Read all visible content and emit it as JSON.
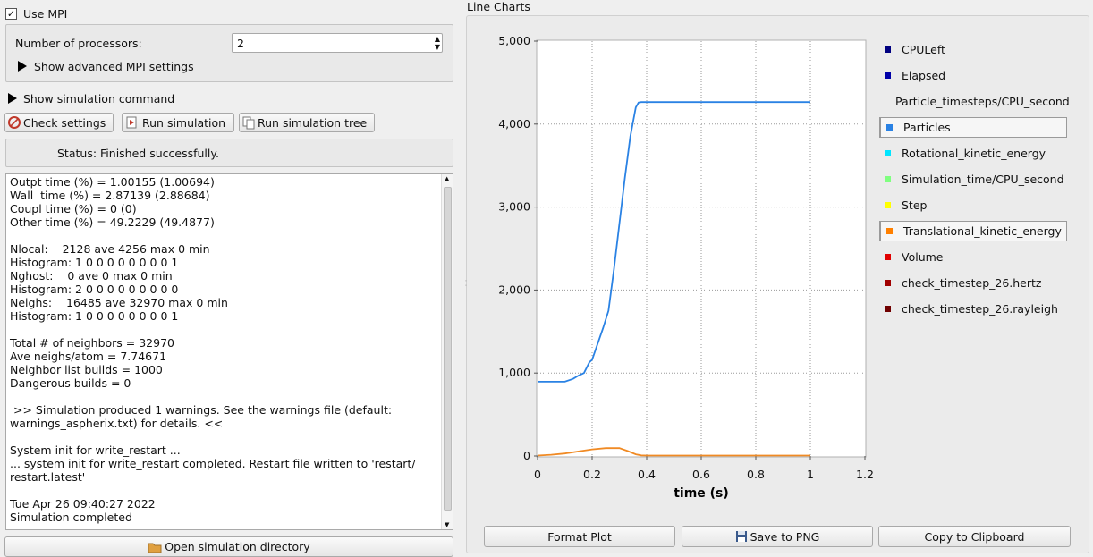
{
  "mpi": {
    "use_mpi_label": "Use MPI",
    "use_mpi_checked": true,
    "processors_label": "Number of processors:",
    "processors_value": "2",
    "advanced_label": "Show advanced MPI settings"
  },
  "simulation": {
    "show_command_label": "Show simulation command",
    "check_settings": "Check settings",
    "run_simulation": "Run simulation",
    "run_tree": "Run simulation tree",
    "status": "Status: Finished successfully.",
    "open_dir": "Open simulation directory"
  },
  "log_lines": [
    "Outpt time (%) = 1.00155 (1.00694)",
    "Wall  time (%) = 2.87139 (2.88684)",
    "Coupl time (%) = 0 (0)",
    "Other time (%) = 49.2229 (49.4877)",
    "",
    "Nlocal:    2128 ave 4256 max 0 min",
    "Histogram: 1 0 0 0 0 0 0 0 0 1",
    "Nghost:    0 ave 0 max 0 min",
    "Histogram: 2 0 0 0 0 0 0 0 0 0",
    "Neighs:    16485 ave 32970 max 0 min",
    "Histogram: 1 0 0 0 0 0 0 0 0 1",
    "",
    "Total # of neighbors = 32970",
    "Ave neighs/atom = 7.74671",
    "Neighbor list builds = 1000",
    "Dangerous builds = 0",
    "",
    " >> Simulation produced 1 warnings. See the warnings file (default:",
    "warnings_aspherix.txt) for details. <<",
    "",
    "System init for write_restart ...",
    "... system init for write_restart completed. Restart file written to 'restart/",
    "restart.latest'",
    "",
    "Tue Apr 26 09:40:27 2022",
    "Simulation completed"
  ],
  "charts": {
    "panel_title": "Line Charts",
    "format_plot": "Format Plot",
    "save_png": "Save to PNG",
    "copy_clipboard": "Copy to Clipboard",
    "legend": [
      {
        "label": "CPULeft",
        "color": "#000080",
        "selected": false
      },
      {
        "label": "Elapsed",
        "color": "#0000a8",
        "selected": false
      },
      {
        "label": "Particle_timesteps/CPU_second",
        "color": "#0000ff",
        "selected": false
      },
      {
        "label": "Particles",
        "color": "#2a82e4",
        "selected": true
      },
      {
        "label": "Rotational_kinetic_energy",
        "color": "#00e5ff",
        "selected": false
      },
      {
        "label": "Simulation_time/CPU_second",
        "color": "#80ff80",
        "selected": false
      },
      {
        "label": "Step",
        "color": "#ffff00",
        "selected": false
      },
      {
        "label": "Translational_kinetic_energy",
        "color": "#ff8000",
        "selected": true
      },
      {
        "label": "Volume",
        "color": "#e00000",
        "selected": false
      },
      {
        "label": "check_timestep_26.hertz",
        "color": "#a00000",
        "selected": false
      },
      {
        "label": "check_timestep_26.rayleigh",
        "color": "#700000",
        "selected": false
      }
    ]
  },
  "chart_data": {
    "type": "line",
    "title": "",
    "xlabel": "time (s)",
    "ylabel": "",
    "xlim": [
      0,
      1.2
    ],
    "ylim": [
      0,
      5000
    ],
    "xticks": [
      "0",
      "0.2",
      "0.4",
      "0.6",
      "0.8",
      "1",
      "1.2"
    ],
    "yticks": [
      "0",
      "1,000",
      "2,000",
      "3,000",
      "4,000",
      "5,000"
    ],
    "grid": true,
    "series": [
      {
        "name": "Particles",
        "color": "#2a82e4",
        "x": [
          0,
          0.05,
          0.1,
          0.13,
          0.15,
          0.17,
          0.19,
          0.2,
          0.22,
          0.24,
          0.26,
          0.28,
          0.3,
          0.32,
          0.34,
          0.36,
          0.37,
          0.38,
          0.4,
          0.6,
          0.8,
          1.0
        ],
        "y": [
          895,
          895,
          895,
          930,
          970,
          1000,
          1130,
          1160,
          1350,
          1540,
          1750,
          2250,
          2800,
          3350,
          3850,
          4200,
          4260,
          4265,
          4265,
          4265,
          4265,
          4265
        ]
      },
      {
        "name": "Translational_kinetic_energy",
        "color": "#f08a24",
        "x": [
          0,
          0.05,
          0.1,
          0.15,
          0.2,
          0.25,
          0.3,
          0.33,
          0.36,
          0.38,
          0.4,
          0.6,
          0.8,
          1.0
        ],
        "y": [
          5,
          15,
          30,
          55,
          80,
          95,
          95,
          60,
          20,
          8,
          5,
          5,
          5,
          5
        ]
      }
    ]
  }
}
